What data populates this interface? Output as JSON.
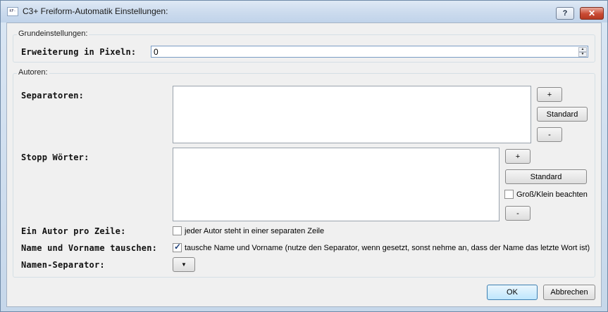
{
  "window": {
    "title": "C3+ Freiform-Automatik Einstellungen:",
    "icon_text": "KF-C3",
    "help_glyph": "?",
    "close_glyph": "✕"
  },
  "basic": {
    "group_label": "Grundeinstellungen:",
    "expansion_label": "Erweiterung in Pixeln:",
    "expansion_value": "0"
  },
  "authors": {
    "group_label": "Autoren:",
    "separators_label": "Separatoren:",
    "stopwords_label": "Stopp Wörter:",
    "add_label": "+",
    "standard_label": "Standard",
    "remove_label": "-",
    "case_sensitive_label": "Groß/Klein beachten",
    "case_sensitive_checked": false,
    "one_author_label": "Ein Autor pro Zeile:",
    "one_author_check_label": "jeder Autor steht in einer separaten Zeile",
    "one_author_checked": false,
    "swap_label": "Name und Vorname tauschen:",
    "swap_check_label": "tausche Name und Vorname (nutze den Separator, wenn gesetzt, sonst nehme an, dass der Name das letzte Wort ist)",
    "swap_checked": true,
    "name_sep_label": "Namen-Separator:",
    "name_sep_value": "",
    "combo_arrow": "▼"
  },
  "footer": {
    "ok_label": "OK",
    "cancel_label": "Abbrechen"
  }
}
